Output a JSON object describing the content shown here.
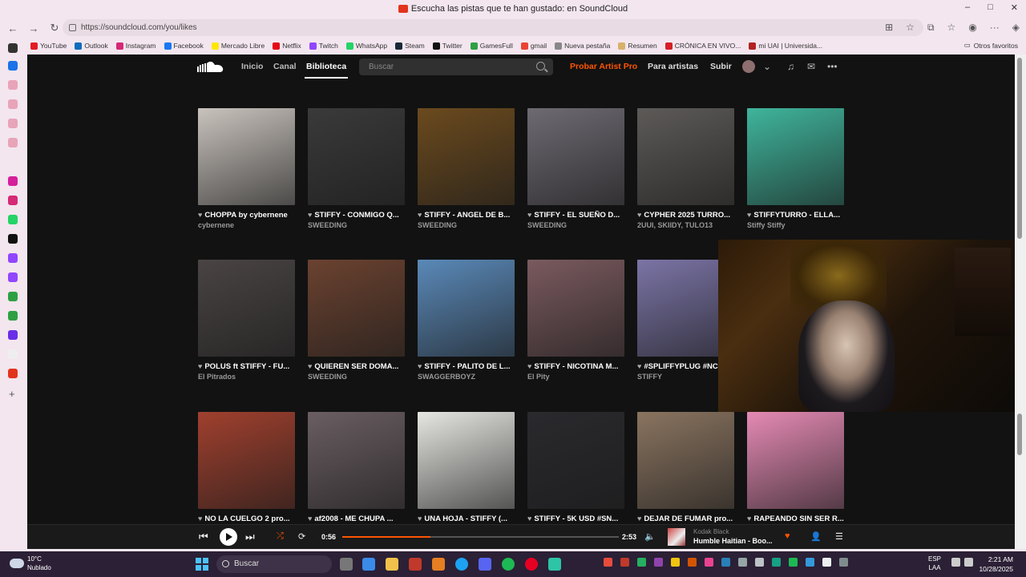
{
  "window": {
    "title": "Escucha las pistas que te han gustado: en SoundCloud",
    "controls": [
      "–",
      "□",
      "✕"
    ]
  },
  "address": {
    "url": "https://soundcloud.com/you/likes"
  },
  "bookmarks": [
    {
      "label": "YouTube",
      "color": "#e31b23"
    },
    {
      "label": "Outlook",
      "color": "#0f6cbd"
    },
    {
      "label": "Instagram",
      "color": "#d62976"
    },
    {
      "label": "Facebook",
      "color": "#1877f2"
    },
    {
      "label": "Mercado Libre",
      "color": "#ffe600"
    },
    {
      "label": "Netflix",
      "color": "#e50914"
    },
    {
      "label": "Twitch",
      "color": "#9146ff"
    },
    {
      "label": "WhatsApp",
      "color": "#25d366"
    },
    {
      "label": "Steam",
      "color": "#1b2838"
    },
    {
      "label": "Twitter",
      "color": "#111111"
    },
    {
      "label": "GamesFull",
      "color": "#2ea043"
    },
    {
      "label": "gmail",
      "color": "#ea4335"
    },
    {
      "label": "Nueva pestaña",
      "color": "#888888"
    },
    {
      "label": "Resumen",
      "color": "#d8b16a"
    },
    {
      "label": "CRÓNICA EN VIVO...",
      "color": "#d61f26"
    },
    {
      "label": "mi UAI | Universida...",
      "color": "#b22222"
    }
  ],
  "bookmarks_other": "Otros favoritos",
  "sc": {
    "nav": {
      "home": "Inicio",
      "feed": "Canal",
      "library": "Biblioteca"
    },
    "search_placeholder": "Buscar",
    "try_pro": "Probar Artist Pro",
    "for_artists": "Para artistas",
    "upload": "Subir"
  },
  "tracks": [
    {
      "title": "CHOPPA by cybernene",
      "artist": "cybernene",
      "art": "#c9c3bd"
    },
    {
      "title": "STIFFY - CONMIGO Q...",
      "artist": "SWEEDING",
      "art": "#3a3a3a"
    },
    {
      "title": "STIFFY - ANGEL DE B...",
      "artist": "SWEEDING",
      "art": "#6b4a1e"
    },
    {
      "title": "STIFFY - EL SUEÑO D...",
      "artist": "SWEEDING",
      "art": "#6e6a72"
    },
    {
      "title": "CYPHER 2025 TURRO...",
      "artist": "2UUI, SKIIDY, TULO13",
      "art": "#5d5a58"
    },
    {
      "title": "STIFFYTURRO - ELLA...",
      "artist": "Stiffy Stiffy",
      "art": "#3fb59c"
    },
    {
      "title": "POLUS ft STIFFY - FU...",
      "artist": "El Pitrados",
      "art": "#4a4444"
    },
    {
      "title": "QUIEREN SER DOMA...",
      "artist": "SWEEDING",
      "art": "#6b4230"
    },
    {
      "title": "STIFFY - PALITO DE L...",
      "artist": "SWAGGERBOYZ",
      "art": "#5a89b8"
    },
    {
      "title": "STIFFY - NICOTINA M...",
      "artist": "El Pity",
      "art": "#7a5a5e"
    },
    {
      "title": "#SPLIFFYPLUG #NC...",
      "artist": "STIFFY",
      "art": "#7b74a6"
    },
    {
      "title": "NO LA CUELGO 2 pro...",
      "artist": "",
      "art": "#a0402e"
    },
    {
      "title": "af2008 - ME CHUPA ...",
      "artist": "",
      "art": "#6a5e62"
    },
    {
      "title": "UNA HOJA - STIFFY (...",
      "artist": "",
      "art": "#e6e6e2"
    },
    {
      "title": "STIFFY - 5K USD #SN...",
      "artist": "",
      "art": "#2a2a2e"
    },
    {
      "title": "DEJAR DE FUMAR pro...",
      "artist": "",
      "art": "#8a7460"
    },
    {
      "title": "RAPEANDO SIN SER R...",
      "artist": "",
      "art": "#e58ab4"
    }
  ],
  "player": {
    "elapsed": "0:56",
    "duration": "2:53",
    "progress": 0.32,
    "artist": "Kodak Black",
    "title": "Humble Haitian - Boo..."
  },
  "taskbar": {
    "temp": "10°C",
    "weather": "Nublado",
    "search": "Buscar",
    "lang1": "ESP",
    "lang2": "LAA",
    "time": "2:21 AM",
    "date": "10/28/2025"
  }
}
